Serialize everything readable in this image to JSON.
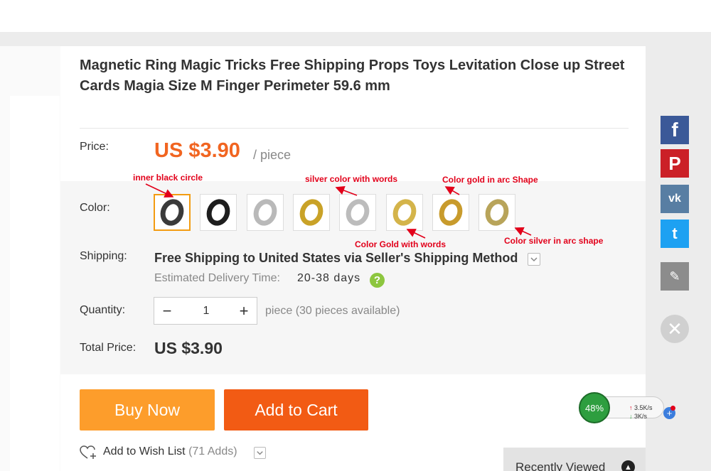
{
  "product": {
    "title": "Magnetic Ring Magic Tricks Free Shipping Props Toys Levitation Close up Street Cards Magia Size M Finger Perimeter 59.6 mm"
  },
  "price": {
    "label": "Price:",
    "value": "US $3.90",
    "unit": "/ piece",
    "color": "#f16521"
  },
  "color": {
    "label": "Color:",
    "selected_index": 0,
    "swatches": [
      {
        "ring_color": "#3a3a3a"
      },
      {
        "ring_color": "#1e1e1e"
      },
      {
        "ring_color": "#b9b9b9"
      },
      {
        "ring_color": "#c9a227"
      },
      {
        "ring_color": "#bcbcbc"
      },
      {
        "ring_color": "#d4b44a"
      },
      {
        "ring_color": "#c89b2c"
      },
      {
        "ring_color": "#b8a45a"
      }
    ],
    "annotations": [
      "inner black circle",
      "silver color with words",
      "Color gold in arc Shape",
      "Color Gold with words",
      "Color silver in arc shape"
    ]
  },
  "shipping": {
    "label": "Shipping:",
    "method": "Free Shipping to United States via Seller's Shipping Method",
    "est_label": "Estimated Delivery Time:",
    "est_days": "20-38 days",
    "help_icon": "?"
  },
  "quantity": {
    "label": "Quantity:",
    "value": "1",
    "minus": "−",
    "plus": "+",
    "available": "piece (30 pieces available)"
  },
  "total": {
    "label": "Total Price:",
    "value": "US $3.90"
  },
  "actions": {
    "buy_now": "Buy Now",
    "add_to_cart": "Add to Cart",
    "buy_color": "#fd9d2b",
    "cart_color": "#f25b14"
  },
  "wishlist": {
    "label": "Add to Wish List",
    "count": "(71 Adds)"
  },
  "recently_viewed": {
    "label": "Recently Viewed"
  },
  "social": {
    "facebook": "f",
    "pinterest": "P",
    "vk": "vk",
    "twitter": "t",
    "edit": "✎",
    "close": "✕"
  },
  "speed_widget": {
    "percent": "48%",
    "up": "3.5K/s",
    "down": "3K/s",
    "plus": "+"
  }
}
